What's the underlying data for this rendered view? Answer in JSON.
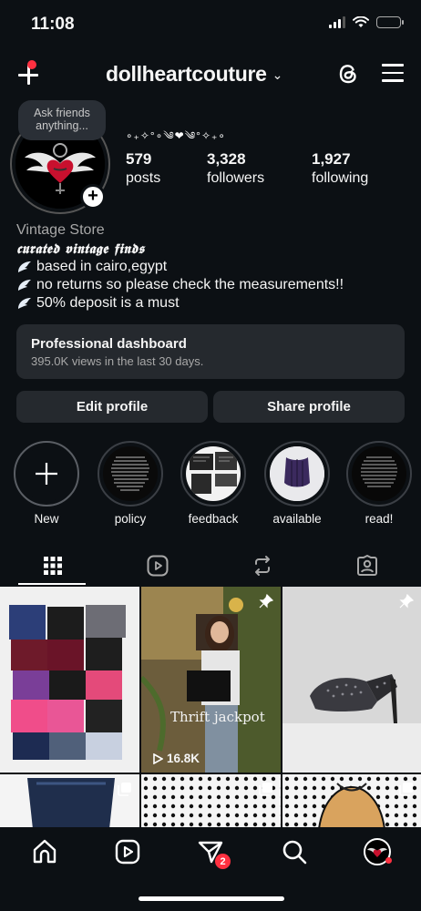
{
  "status_bar": {
    "time": "11:08"
  },
  "header": {
    "username": "dollheartcouture",
    "icons": [
      "create-plus-icon",
      "chevron-down-icon",
      "threads-icon",
      "menu-icon"
    ]
  },
  "profile": {
    "note": "Ask friends anything...",
    "decoration": "∘₊✧°∘༄❤︎༄°✧₊∘",
    "stats": [
      {
        "num": "579",
        "label": "posts"
      },
      {
        "num": "3,328",
        "label": "followers"
      },
      {
        "num": "1,927",
        "label": "following"
      }
    ],
    "category": "Vintage Store",
    "bio_lines": [
      "𝖈𝖚𝖗𝖆𝖙𝖊𝖉 𝖛𝖎𝖓𝖙𝖆𝖌𝖊 𝖋𝖎𝖓𝖉𝖘",
      "based in cairo,egypt",
      "no returns so please check the measurements!!",
      "50% deposit is a must"
    ]
  },
  "dashboard": {
    "title": "Professional dashboard",
    "subtitle": "395.0K views in the last 30 days."
  },
  "actions": {
    "edit": "Edit profile",
    "share": "Share profile"
  },
  "highlights": [
    {
      "label": "New"
    },
    {
      "label": "policy"
    },
    {
      "label": "feedback"
    },
    {
      "label": "available"
    },
    {
      "label": "read!"
    }
  ],
  "tabs": [
    "grid-icon",
    "reels-icon",
    "reposts-icon",
    "tagged-icon"
  ],
  "posts": [
    {
      "type": "image",
      "pinned": false
    },
    {
      "type": "reel",
      "pinned": true,
      "views": "16.8K",
      "overlay": "Thrift jackpot"
    },
    {
      "type": "image",
      "pinned": true
    },
    {
      "type": "carousel",
      "pinned": false
    },
    {
      "type": "carousel",
      "pinned": false
    },
    {
      "type": "carousel",
      "pinned": false
    }
  ],
  "bottom_nav": {
    "items": [
      "home-icon",
      "reels-icon",
      "messages-icon",
      "search-icon",
      "profile-avatar"
    ],
    "messages_badge": "2"
  },
  "colors": {
    "background": "#0c1014",
    "card": "#25292e",
    "badge": "#ff3040",
    "muted": "#a8a8a8"
  }
}
